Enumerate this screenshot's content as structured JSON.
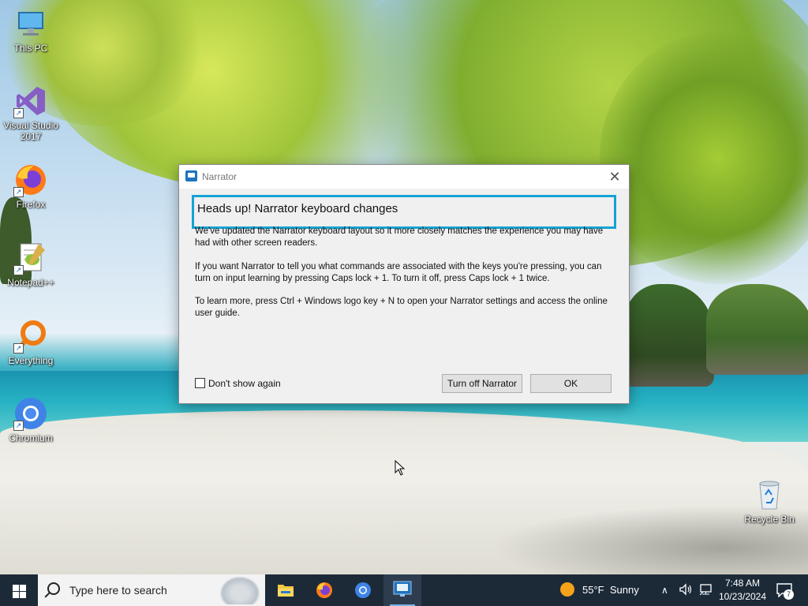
{
  "desktop": {
    "icons": [
      {
        "label": "This PC",
        "icon": "computer-icon"
      },
      {
        "label": "Visual Studio 2017",
        "icon": "visual-studio-icon"
      },
      {
        "label": "Firefox",
        "icon": "firefox-icon"
      },
      {
        "label": "Notepad++",
        "icon": "notepadpp-icon"
      },
      {
        "label": "Everything",
        "icon": "everything-search-icon"
      },
      {
        "label": "Chromium",
        "icon": "chromium-icon"
      },
      {
        "label": "Recycle Bin",
        "icon": "recycle-bin-icon"
      }
    ]
  },
  "dialog": {
    "title": "Narrator",
    "heading": "Heads up! Narrator keyboard changes",
    "paragraphs": [
      "We've updated the Narrator keyboard layout so it more closely matches the experience you may have had with other screen readers.",
      "If you want Narrator to tell you what commands are associated with the keys you're pressing, you can turn on input learning by pressing Caps lock + 1. To turn it off, press Caps lock + 1 twice.",
      "To learn more, press Ctrl + Windows logo key + N to open your Narrator settings and access the online user guide."
    ],
    "checkbox_label": "Don't show again",
    "checkbox_checked": false,
    "turn_off_label": "Turn off Narrator",
    "ok_label": "OK",
    "close_glyph": "✕"
  },
  "taskbar": {
    "search_placeholder": "Type here to search",
    "apps": [
      "file-explorer-icon",
      "firefox-icon",
      "chromium-icon",
      "narrator-icon"
    ],
    "weather_temp": "55°F",
    "weather_desc": "Sunny",
    "time": "7:48 AM",
    "date": "10/23/2024",
    "notification_count": "7"
  }
}
